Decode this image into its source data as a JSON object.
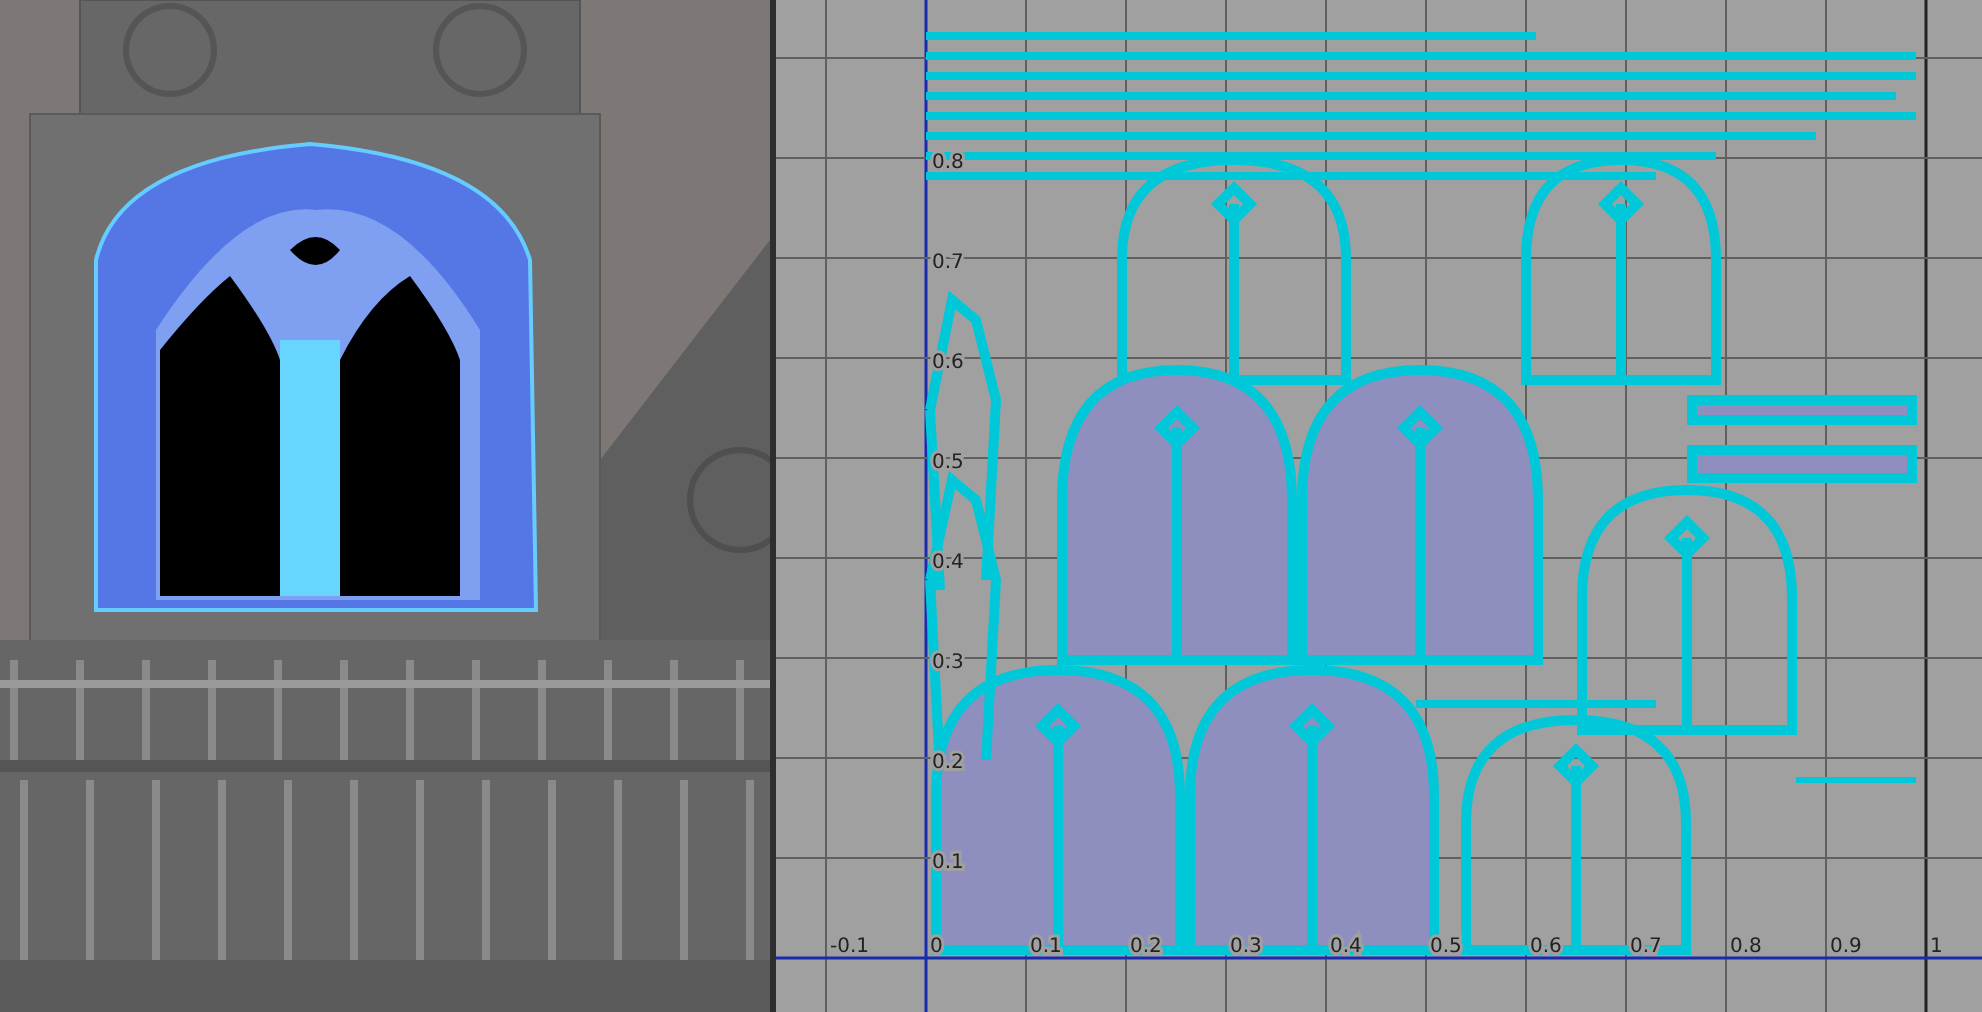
{
  "uv_editor": {
    "u_labels": [
      "-0.1",
      "0",
      "0.1",
      "0.2",
      "0.3",
      "0.4",
      "0.5",
      "0.6",
      "0.7",
      "0.8",
      "0.9",
      "1"
    ],
    "v_labels": [
      "0.8",
      "0.7",
      "0.6",
      "0.5",
      "0.4",
      "0.3",
      "0.2",
      "0.1"
    ]
  }
}
